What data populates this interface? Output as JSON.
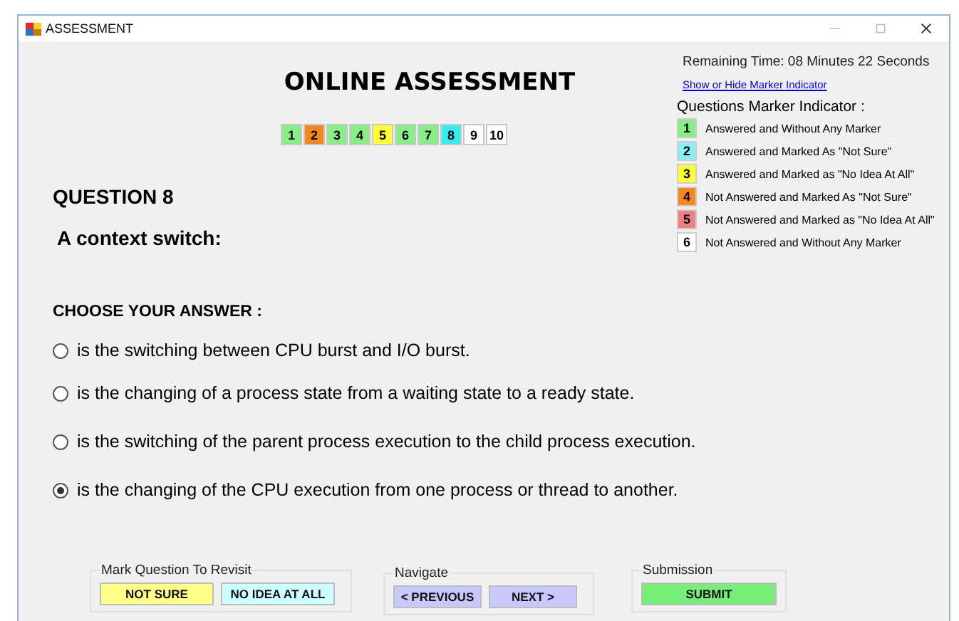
{
  "window": {
    "title": "ASSESSMENT"
  },
  "title": "ONLINE ASSESSMENT",
  "question_nav": [
    {
      "label": "1",
      "color": "#88ee88"
    },
    {
      "label": "2",
      "color": "#f7861e"
    },
    {
      "label": "3",
      "color": "#88ee88"
    },
    {
      "label": "4",
      "color": "#88ee88"
    },
    {
      "label": "5",
      "color": "#ffff33"
    },
    {
      "label": "6",
      "color": "#88ee88"
    },
    {
      "label": "7",
      "color": "#88ee88"
    },
    {
      "label": "8",
      "color": "#33eeee"
    },
    {
      "label": "9",
      "color": "#ffffff"
    },
    {
      "label": "10",
      "color": "#ffffff"
    }
  ],
  "question": {
    "heading": "QUESTION  8",
    "text": "A context switch:"
  },
  "answer_heading": "CHOOSE YOUR ANSWER :",
  "options": [
    {
      "label": "is the switching between CPU burst and I/O burst.",
      "selected": false
    },
    {
      "label": "is the changing of a process state from a waiting state to a ready state.",
      "selected": false
    },
    {
      "label": "is the switching of the parent process execution to the child process execution.",
      "selected": false
    },
    {
      "label": "is the changing of the CPU execution from one process or thread to another.",
      "selected": true
    }
  ],
  "timer": "Remaining Time: 08 Minutes 22 Seconds",
  "marker_toggle_link": "Show or Hide Marker Indicator",
  "marker_legend": {
    "title": "Questions Marker Indicator :",
    "items": [
      {
        "number": "1",
        "label": "Answered and Without Any Marker",
        "color": "#88ee88"
      },
      {
        "number": "2",
        "label": "Answered and Marked As \"Not Sure\"",
        "color": "#88f0f0"
      },
      {
        "number": "3",
        "label": "Answered and Marked as \"No Idea At All\"",
        "color": "#ffff33"
      },
      {
        "number": "4",
        "label": "Not Answered and Marked As \"Not Sure\"",
        "color": "#f7861e"
      },
      {
        "number": "5",
        "label": "Not Answered and Marked as \"No Idea At All\"",
        "color": "#f08080"
      },
      {
        "number": "6",
        "label": "Not Answered and Without Any Marker",
        "color": "#ffffff"
      }
    ]
  },
  "groups": [
    {
      "title": "Mark Question To Revisit",
      "buttons": [
        {
          "label": "NOT SURE",
          "color": "#ffff88"
        },
        {
          "label": "NO IDEA AT ALL",
          "color": "#ccffff"
        }
      ]
    },
    {
      "title": "Navigate",
      "buttons": [
        {
          "label": "< PREVIOUS",
          "color": "#c8c8ff"
        },
        {
          "label": "NEXT >",
          "color": "#c8c8ff"
        }
      ]
    },
    {
      "title": "Submission",
      "buttons": [
        {
          "label": "SUBMIT",
          "color": "#77ee77"
        }
      ]
    }
  ]
}
